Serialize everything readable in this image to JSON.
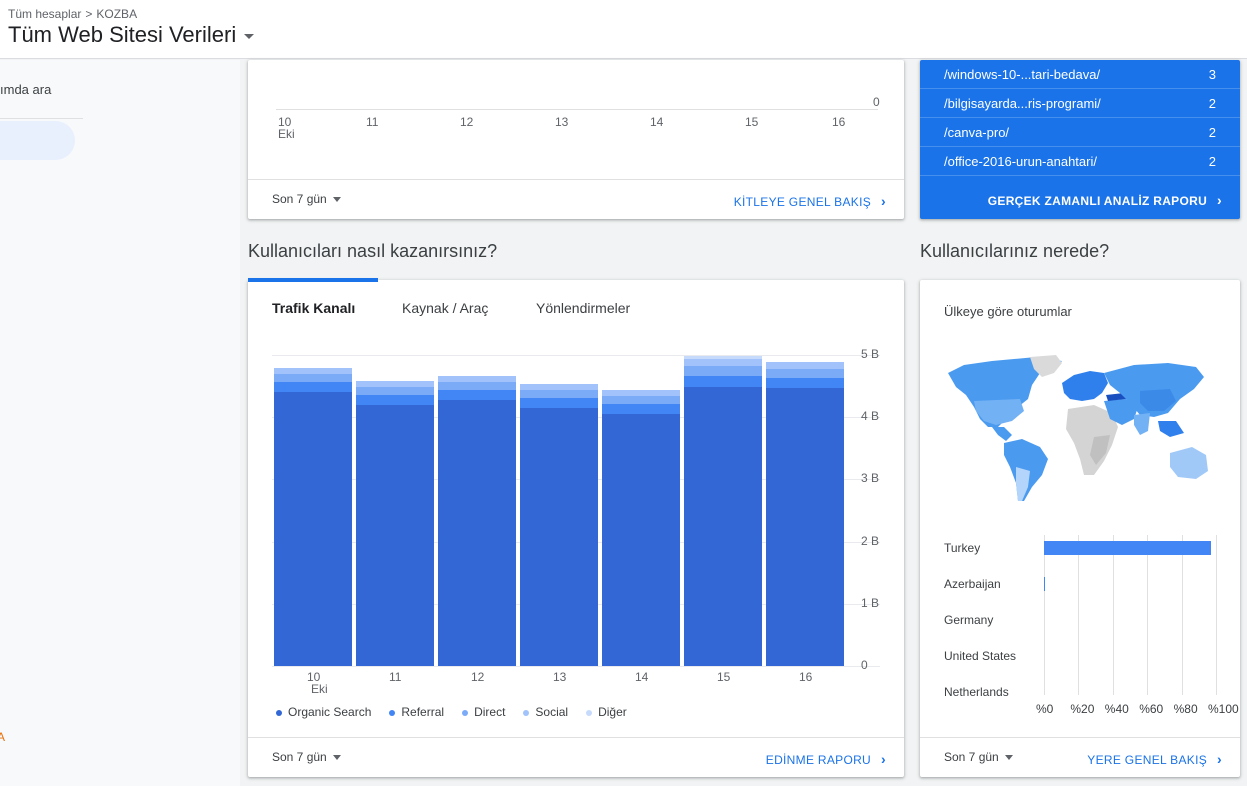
{
  "header": {
    "breadcrumb_root": "Tüm hesaplar",
    "breadcrumb_sep": ">",
    "breadcrumb_account": "KOZBA",
    "property_title": "Tüm Web Sitesi Verileri"
  },
  "sidebar": {
    "search_text": "ımda ara",
    "warning_glyph": "A"
  },
  "audience_card": {
    "x_ticks": [
      "10",
      "11",
      "12",
      "13",
      "14",
      "15",
      "16"
    ],
    "x_sub": "Eki",
    "y_zero": "0",
    "period": "Son 7 gün",
    "link": "KİTLEYE GENEL BAKIŞ"
  },
  "realtime_card": {
    "rows": [
      {
        "page": "/windows-10-...tari-bedava/",
        "count": "3"
      },
      {
        "page": "/bilgisayarda...ris-programi/",
        "count": "2"
      },
      {
        "page": "/canva-pro/",
        "count": "2"
      },
      {
        "page": "/office-2016-urun-anahtari/",
        "count": "2"
      }
    ],
    "link": "GERÇEK ZAMANLI ANALİZ RAPORU"
  },
  "acquisition": {
    "section_title": "Kullanıcıları nasıl kazanırsınız?",
    "tabs": [
      "Trafik Kanalı",
      "Kaynak / Araç",
      "Yönlendirmeler"
    ],
    "period": "Son 7 gün",
    "link": "EDİNME RAPORU"
  },
  "geo": {
    "section_title": "Kullanıcılarınız nerede?",
    "subtitle": "Ülkeye göre oturumlar",
    "countries": [
      "Turkey",
      "Azerbaijan",
      "Germany",
      "United States",
      "Netherlands"
    ],
    "shares": [
      97,
      0.5,
      0,
      0,
      0
    ],
    "pct_ticks": [
      "%0",
      "%20",
      "%40",
      "%60",
      "%80",
      "%100"
    ],
    "period": "Son 7 gün",
    "link": "YERE GENEL BAKIŞ"
  },
  "chart_data": {
    "type": "bar",
    "stacked": true,
    "categories": [
      "10",
      "11",
      "12",
      "13",
      "14",
      "15",
      "16"
    ],
    "x_sub_label": "Eki",
    "y_ticks": [
      "0",
      "1 B",
      "2 B",
      "3 B",
      "4 B",
      "5 B"
    ],
    "ylim": [
      0,
      5000
    ],
    "legend_position": "bottom",
    "series": [
      {
        "name": "Organic Search",
        "color": "#3367d6",
        "values": [
          4400,
          4200,
          4270,
          4150,
          4050,
          4480,
          4470
        ]
      },
      {
        "name": "Referral",
        "color": "#4285f4",
        "values": [
          160,
          160,
          160,
          160,
          160,
          180,
          160
        ]
      },
      {
        "name": "Direct",
        "color": "#7baaf7",
        "values": [
          130,
          130,
          130,
          130,
          130,
          170,
          150
        ]
      },
      {
        "name": "Social",
        "color": "#a1c2fa",
        "values": [
          100,
          100,
          100,
          100,
          100,
          110,
          110
        ]
      },
      {
        "name": "Diğer",
        "color": "#c6dafc",
        "values": [
          0,
          0,
          0,
          0,
          0,
          50,
          0
        ]
      }
    ]
  }
}
